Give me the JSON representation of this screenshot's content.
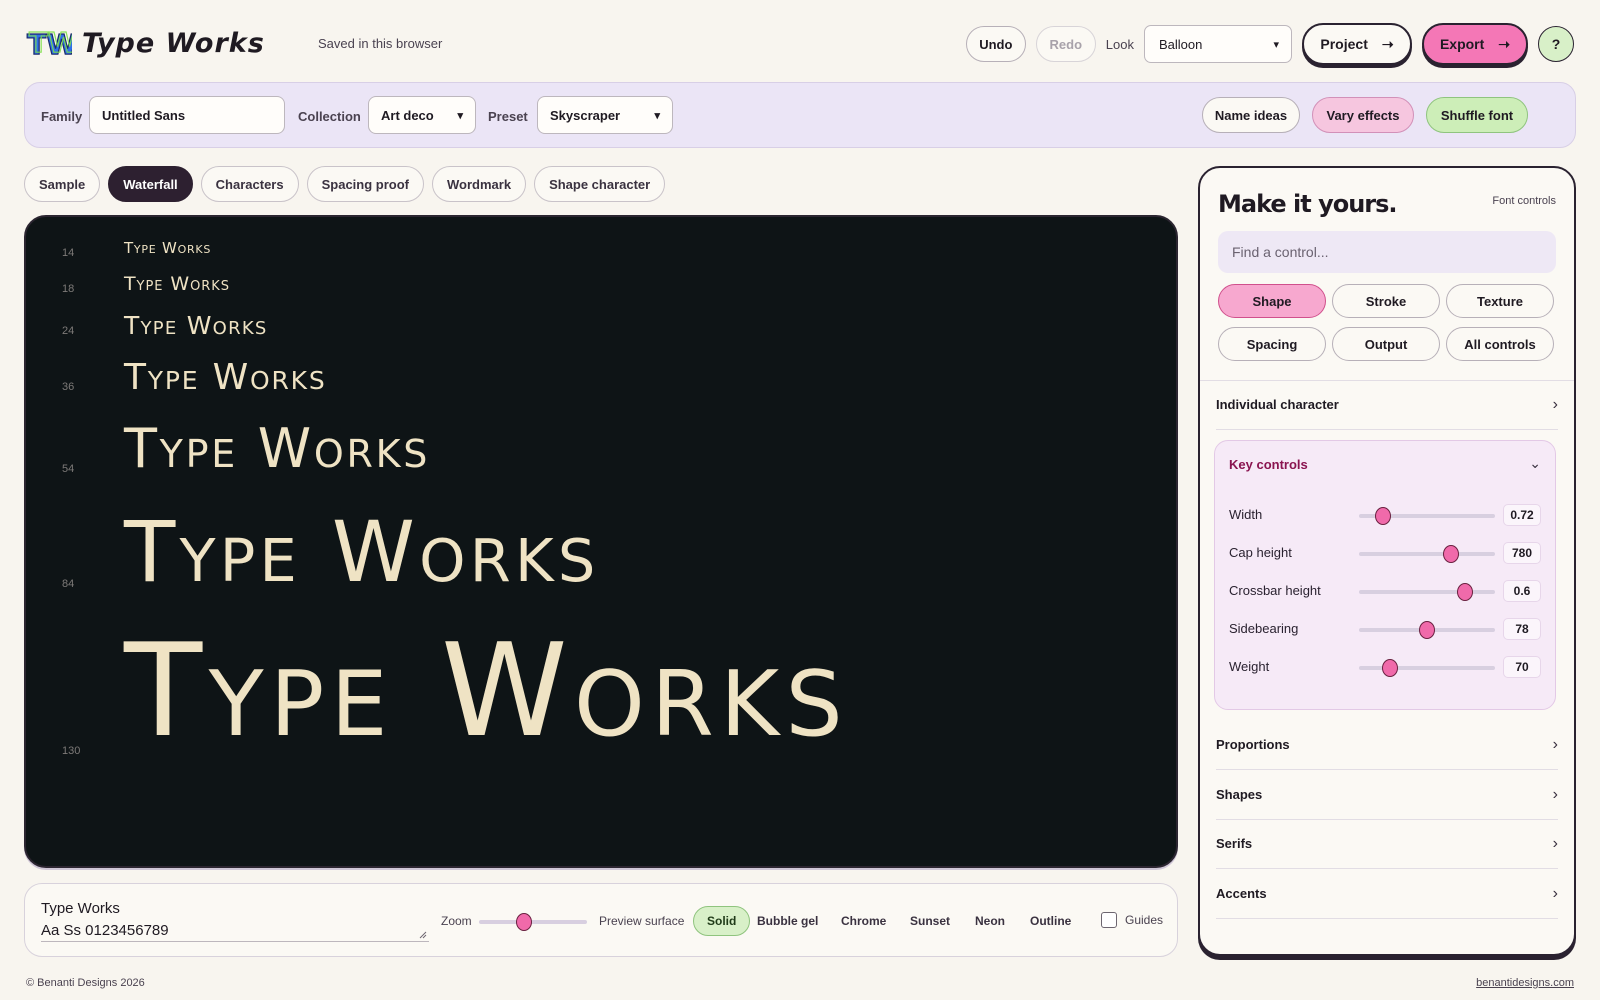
{
  "header": {
    "logo_mark": "TW",
    "logo_text": "Type Works",
    "saved_status": "Saved in this browser",
    "undo_label": "Undo",
    "redo_label": "Redo",
    "look_label": "Look",
    "look_value": "Balloon",
    "project_label": "Project",
    "export_label": "Export",
    "help_label": "?"
  },
  "toolbar": {
    "family_label": "Family",
    "family_value": "Untitled Sans",
    "collection_label": "Collection",
    "collection_value": "Art deco",
    "preset_label": "Preset",
    "preset_value": "Skyscraper",
    "name_ideas_label": "Name ideas",
    "vary_effects_label": "Vary effects",
    "shuffle_font_label": "Shuffle font"
  },
  "tabs": [
    {
      "label": "Sample",
      "active": false
    },
    {
      "label": "Waterfall",
      "active": true
    },
    {
      "label": "Characters",
      "active": false
    },
    {
      "label": "Spacing proof",
      "active": false
    },
    {
      "label": "Wordmark",
      "active": false
    },
    {
      "label": "Shape character",
      "active": false
    }
  ],
  "waterfall": {
    "text": "Type Works",
    "rows": [
      {
        "size": "14"
      },
      {
        "size": "18"
      },
      {
        "size": "24"
      },
      {
        "size": "36"
      },
      {
        "size": "54"
      },
      {
        "size": "84"
      },
      {
        "size": "130"
      }
    ]
  },
  "bottom": {
    "sample_line1": "Type Works",
    "sample_line2": "Aa Ss 0123456789",
    "zoom_label": "Zoom",
    "zoom_value": 0.42,
    "surface_label": "Preview surface",
    "surfaces": [
      {
        "label": "Solid",
        "active": true
      },
      {
        "label": "Bubble gel",
        "active": false
      },
      {
        "label": "Chrome",
        "active": false
      },
      {
        "label": "Sunset",
        "active": false
      },
      {
        "label": "Neon",
        "active": false
      },
      {
        "label": "Outline",
        "active": false
      }
    ],
    "guides_label": "Guides",
    "guides_checked": false
  },
  "panel": {
    "title": "Make it yours.",
    "subtitle": "Font controls",
    "search_placeholder": "Find a control...",
    "categories": [
      {
        "label": "Shape",
        "active": true
      },
      {
        "label": "Stroke",
        "active": false
      },
      {
        "label": "Texture",
        "active": false
      },
      {
        "label": "Spacing",
        "active": false
      },
      {
        "label": "Output",
        "active": false
      },
      {
        "label": "All controls",
        "active": false
      }
    ],
    "individual_character": "Individual character",
    "key_controls_title": "Key controls",
    "controls": [
      {
        "label": "Width",
        "value": "0.72",
        "fraction": 0.18
      },
      {
        "label": "Cap height",
        "value": "780",
        "fraction": 0.68
      },
      {
        "label": "Crossbar height",
        "value": "0.6",
        "fraction": 0.78
      },
      {
        "label": "Sidebearing",
        "value": "78",
        "fraction": 0.5
      },
      {
        "label": "Weight",
        "value": "70",
        "fraction": 0.23
      }
    ],
    "sections": [
      "Proportions",
      "Shapes",
      "Serifs",
      "Accents"
    ]
  },
  "footer": {
    "copyright": "© Benanti Designs 2026",
    "link": "benantidesigns.com"
  },
  "colors": {
    "accent_pink": "#f477b6",
    "accent_green": "#d8f0c8",
    "preview_bg": "#0e1416",
    "preview_text": "#efe3c4",
    "toolbar_bg": "#ebe5f6"
  }
}
